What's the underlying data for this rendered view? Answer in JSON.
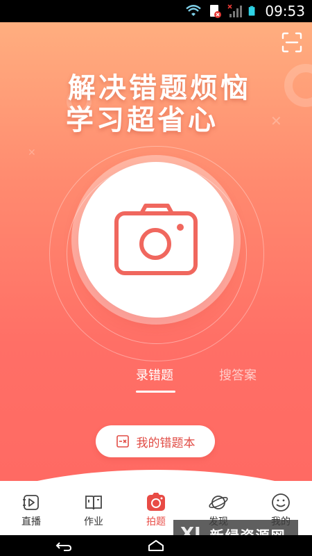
{
  "status_bar": {
    "time": "09:53",
    "icons": [
      "wifi-icon",
      "sim-icon",
      "signal-icon",
      "battery-icon"
    ]
  },
  "header": {
    "scan_icon": "scan-frame-icon"
  },
  "hero": {
    "headline_line1": "解决错题烦恼",
    "headline_line2": "学习超省心",
    "camera_icon": "camera-icon"
  },
  "mode_tabs": [
    {
      "label": "录错题",
      "active": true
    },
    {
      "label": "搜答案",
      "active": false
    }
  ],
  "notebook_button": {
    "label": "我的错题本",
    "icon": "notebook-icon"
  },
  "bottom_nav": [
    {
      "label": "直播",
      "icon": "live-play-icon",
      "active": false
    },
    {
      "label": "作业",
      "icon": "homework-book-icon",
      "active": false
    },
    {
      "label": "拍题",
      "icon": "camera-icon",
      "active": true
    },
    {
      "label": "发现",
      "icon": "planet-icon",
      "active": false
    },
    {
      "label": "我的",
      "icon": "smiley-icon",
      "active": false
    }
  ],
  "watermark": {
    "text": "新绿资源网",
    "logo": "XL"
  },
  "system_nav": [
    "back-icon",
    "home-icon"
  ],
  "colors": {
    "accent": "#e84b45",
    "hero_top": "#ffae7f",
    "hero_bottom": "#ff6a63"
  }
}
